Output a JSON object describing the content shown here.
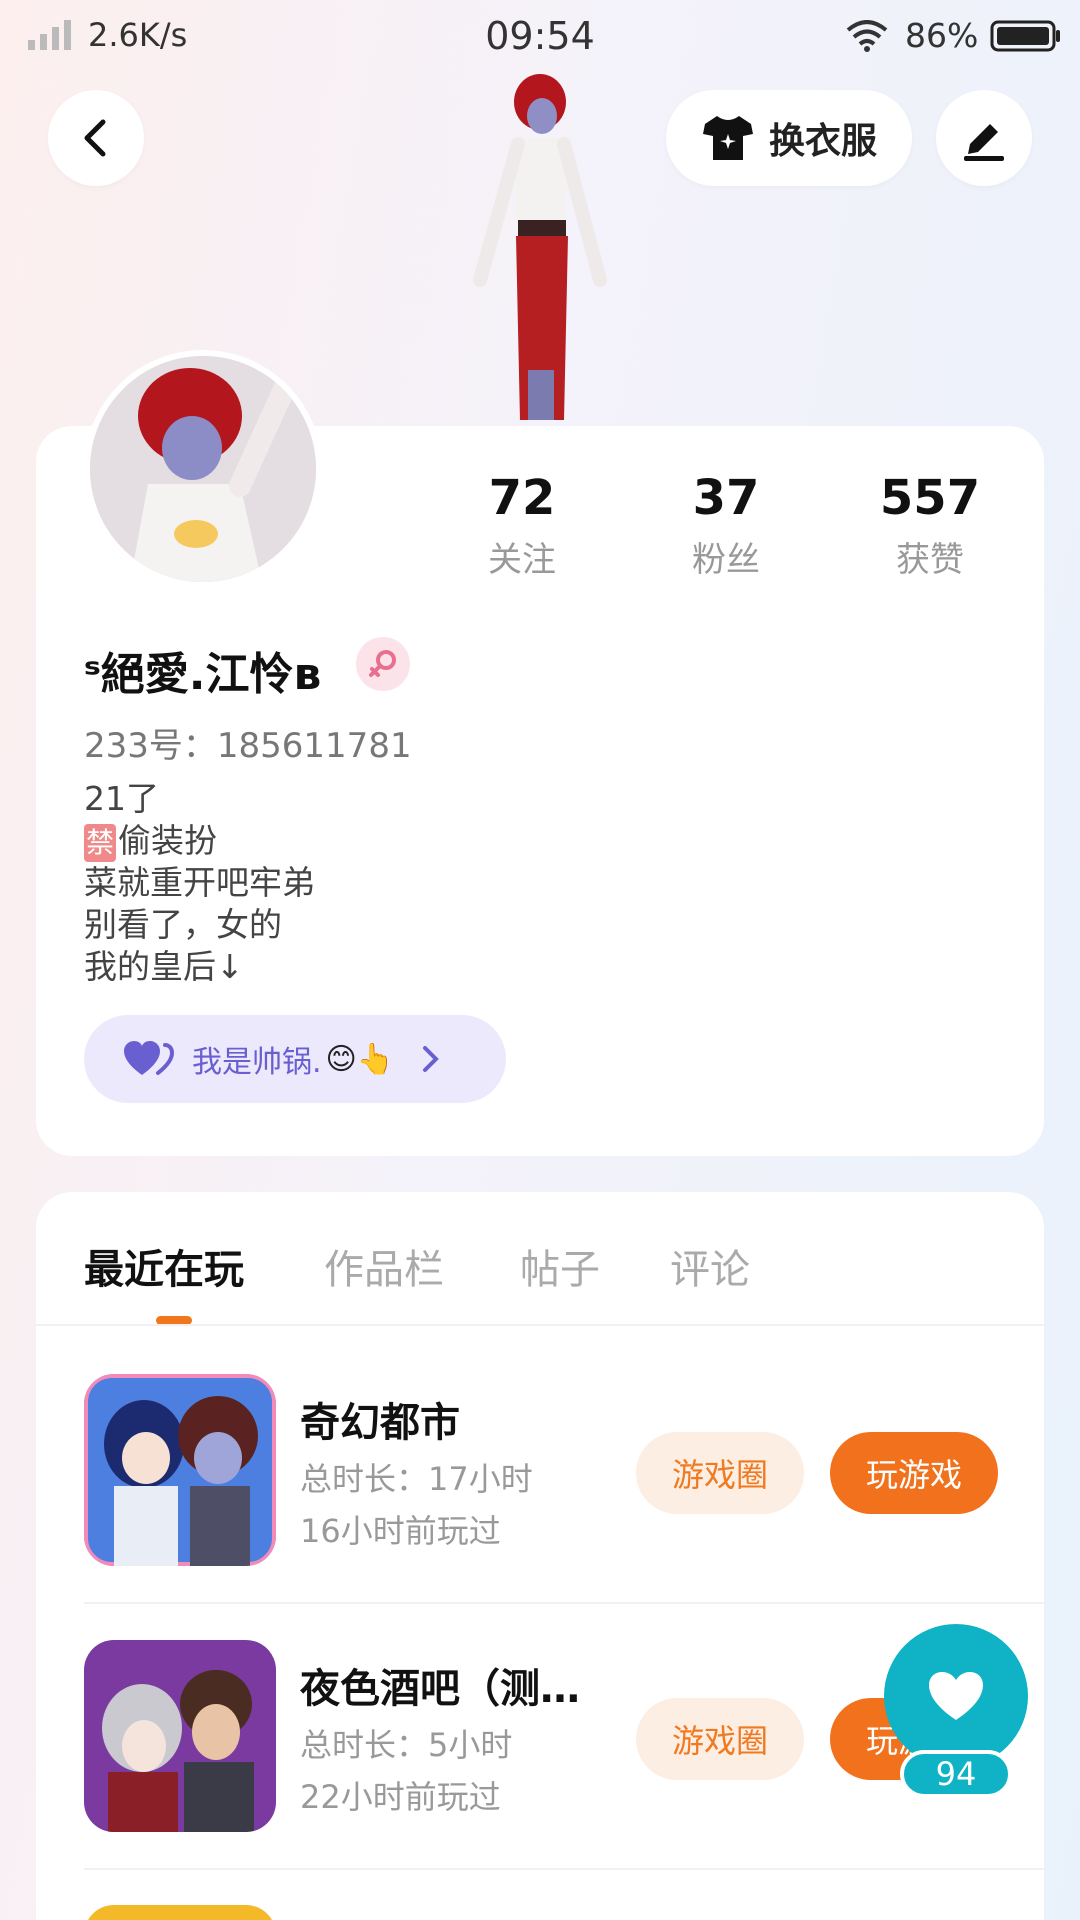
{
  "status_bar": {
    "net_speed": "2.6K/s",
    "time": "09:54",
    "battery": "86%"
  },
  "header": {
    "outfit_label": "换衣服"
  },
  "stats": [
    {
      "value": "72",
      "label": "关注"
    },
    {
      "value": "37",
      "label": "粉丝"
    },
    {
      "value": "557",
      "label": "获赞"
    }
  ],
  "profile": {
    "nickname": "ˢ絕愛.江怜ʙ",
    "uid": "233号：185611781",
    "bio": [
      "21了",
      "偷装扮",
      "菜就重开吧牢弟",
      "别看了，女的",
      "我的皇后↓"
    ],
    "ban_tag": "禁",
    "partner": {
      "text": "我是帅锅.",
      "emoji": "😊👆"
    }
  },
  "tabs": [
    "最近在玩",
    "作品栏",
    "帖子",
    "评论"
  ],
  "games": [
    {
      "title": "奇幻都市",
      "duration": "总时长：17小时",
      "last_played": "16小时前玩过",
      "circle_btn": "游戏圈",
      "play_btn": "玩游戏"
    },
    {
      "title": "夜色酒吧（测…",
      "duration": "总时长：5小时",
      "last_played": "22小时前玩过",
      "circle_btn": "游戏圈",
      "play_btn": "玩游戏"
    }
  ],
  "fab": {
    "like_count": "94"
  },
  "colors": {
    "accent": "#f2711c",
    "fab": "#10b3c6",
    "partner_bg": "#ece9fc"
  },
  "icons": [
    "signal-icon",
    "wifi-icon",
    "battery-icon",
    "back-icon",
    "shirt-icon",
    "pen-icon",
    "female-icon",
    "heart-icon"
  ]
}
